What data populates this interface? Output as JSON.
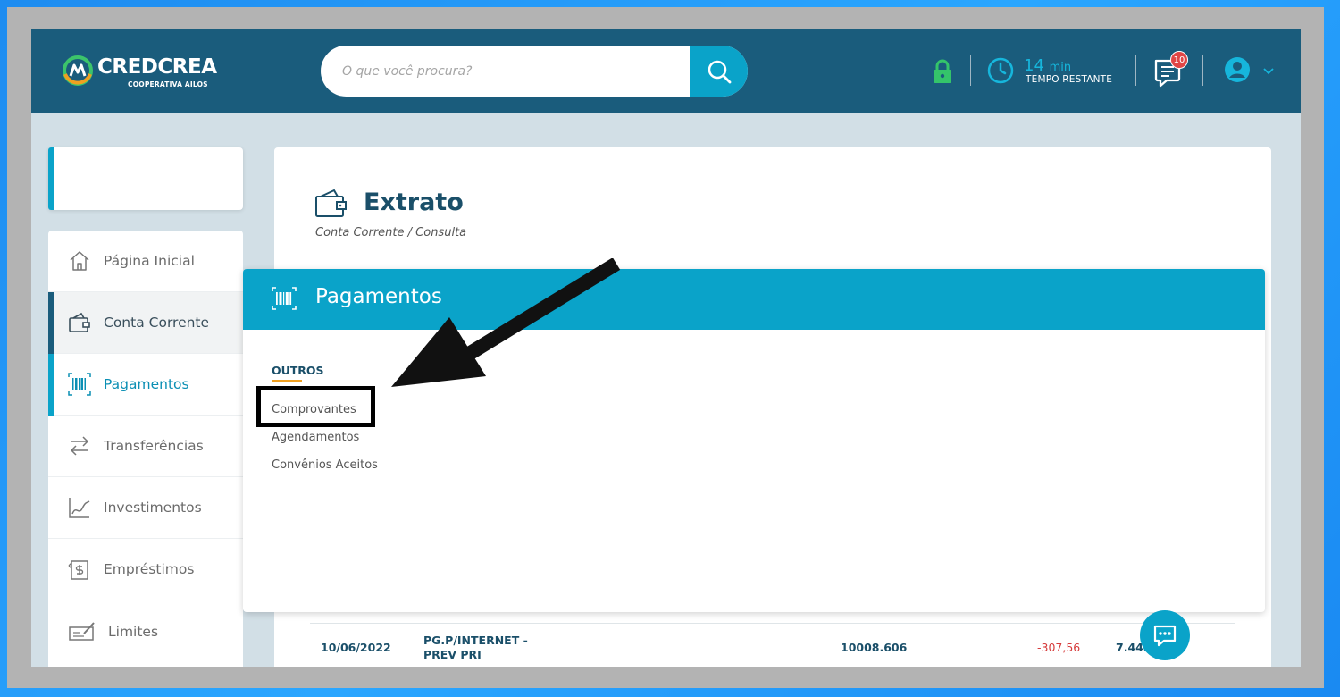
{
  "header": {
    "brand_name": "CREDCREA",
    "brand_subtitle": "COOPERATIVA AILOS",
    "search_placeholder": "O que você procura?",
    "timer_value": "14",
    "timer_unit": "min",
    "timer_label": "TEMPO RESTANTE",
    "notification_count": "10",
    "icons": [
      "search-icon",
      "lock-icon",
      "clock-icon",
      "messages-icon",
      "user-icon",
      "chevron-down-icon"
    ]
  },
  "sidebar": {
    "items": [
      {
        "label": "Página Inicial",
        "icon": "home-icon"
      },
      {
        "label": "Conta Corrente",
        "icon": "wallet-icon"
      },
      {
        "label": "Pagamentos",
        "icon": "barcode-icon"
      },
      {
        "label": "Transferências",
        "icon": "transfer-icon"
      },
      {
        "label": "Investimentos",
        "icon": "chart-icon"
      },
      {
        "label": "Empréstimos",
        "icon": "loan-icon"
      },
      {
        "label": "Limites",
        "icon": "check-icon"
      }
    ]
  },
  "main": {
    "title": "Extrato",
    "breadcrumb": "Conta Corrente / Consulta",
    "row": {
      "date": "10/06/2022",
      "description": "PG.P/INTERNET - PREV PRI",
      "document": "10008.606",
      "value": "-307,56",
      "balance": "7.448"
    }
  },
  "dropdown": {
    "title": "Pagamentos",
    "section": "OUTROS",
    "links": [
      "Comprovantes",
      "Agendamentos",
      "Convênios Aceitos"
    ]
  },
  "colors": {
    "header_bg": "#1a5c7c",
    "accent": "#0aa3c9",
    "negative": "#d63c3c",
    "highlight_underline": "#f0a020"
  }
}
